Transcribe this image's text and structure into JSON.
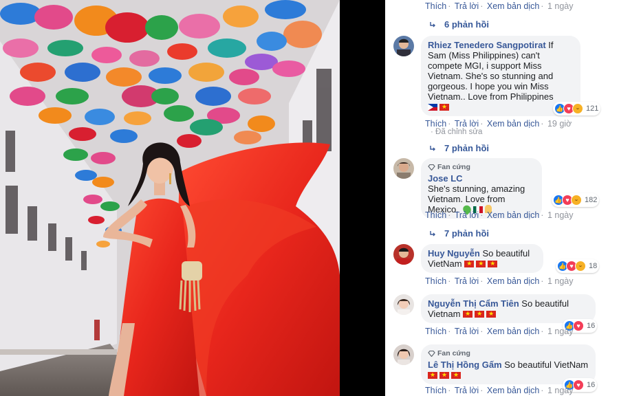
{
  "colors": {
    "link": "#385898",
    "meta": "#90949c",
    "bubble": "#f2f3f5",
    "dress": "#e8261c"
  },
  "actions": {
    "like": "Thích",
    "reply": "Trả lời",
    "translate": "Xem bản dịch"
  },
  "top_row": {
    "time": "1 ngày"
  },
  "replies": [
    {
      "label": "6 phản hồi"
    },
    {
      "label": "7 phản hồi"
    },
    {
      "label": "7 phản hồi"
    }
  ],
  "comments": [
    {
      "name": "Rhiez Tenedero Sangpotirat",
      "text": "If Sam (Miss Philippines) can't compete MGI, i support Miss Vietnam. She's so stunning and gorgeous. I hope you win Miss Vietnam.. Love from Philippines",
      "reactions": "121",
      "time": "19 giờ",
      "edited": "· Đã chỉnh sửa",
      "icons": [
        "like-icon",
        "love-icon",
        "haha-icon"
      ]
    },
    {
      "badge": "Fan cứng",
      "name": "Jose LC",
      "text": "She's stunning, amazing Vietnam. Love from Mexico.",
      "reactions": "182",
      "time": "1 ngày",
      "icons": [
        "like-icon",
        "love-icon",
        "haha-icon"
      ]
    },
    {
      "name": "Huy Nguyễn",
      "text": "So beautiful VietNam",
      "reactions": "18",
      "time": "1 ngày",
      "icons": [
        "like-icon",
        "love-icon",
        "haha-icon"
      ]
    },
    {
      "name": "Nguyễn Thị Cẩm Tiên",
      "text": "So beautiful Vietnam",
      "reactions": "16",
      "time": "1 ngày",
      "icons": [
        "like-icon",
        "love-icon"
      ]
    },
    {
      "badge": "Fan cứng",
      "name": "Lê Thị Hồng Gấm",
      "text": "So beautiful VietNam",
      "reactions": "16",
      "time": "1 ngày",
      "icons": [
        "like-icon",
        "love-icon"
      ]
    }
  ]
}
